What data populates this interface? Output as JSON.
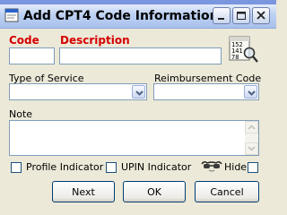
{
  "window": {
    "title": "Add CPT4 Code Information"
  },
  "fields": {
    "code_label": "Code",
    "description_label": "Description",
    "code_value": "",
    "description_value": "",
    "type_of_service_label": "Type of Service",
    "type_of_service_value": "",
    "reimbursement_code_label": "Reimbursement Code",
    "reimbursement_code_value": "",
    "note_label": "Note",
    "note_value": ""
  },
  "lookup_icon": {
    "lines": [
      "152",
      "141",
      "78"
    ]
  },
  "checkboxes": {
    "profile_indicator": {
      "label": "Profile Indicator",
      "checked": false
    },
    "upin_indicator": {
      "label": "UPIN Indicator",
      "checked": false
    },
    "hide": {
      "label": "Hide",
      "checked": false
    }
  },
  "buttons": {
    "next": "Next",
    "ok": "OK",
    "cancel": "Cancel"
  },
  "colors": {
    "required_label": "#D40000",
    "title_bar": "#BCD0F2",
    "dialog_bg": "#ECE9D8"
  }
}
